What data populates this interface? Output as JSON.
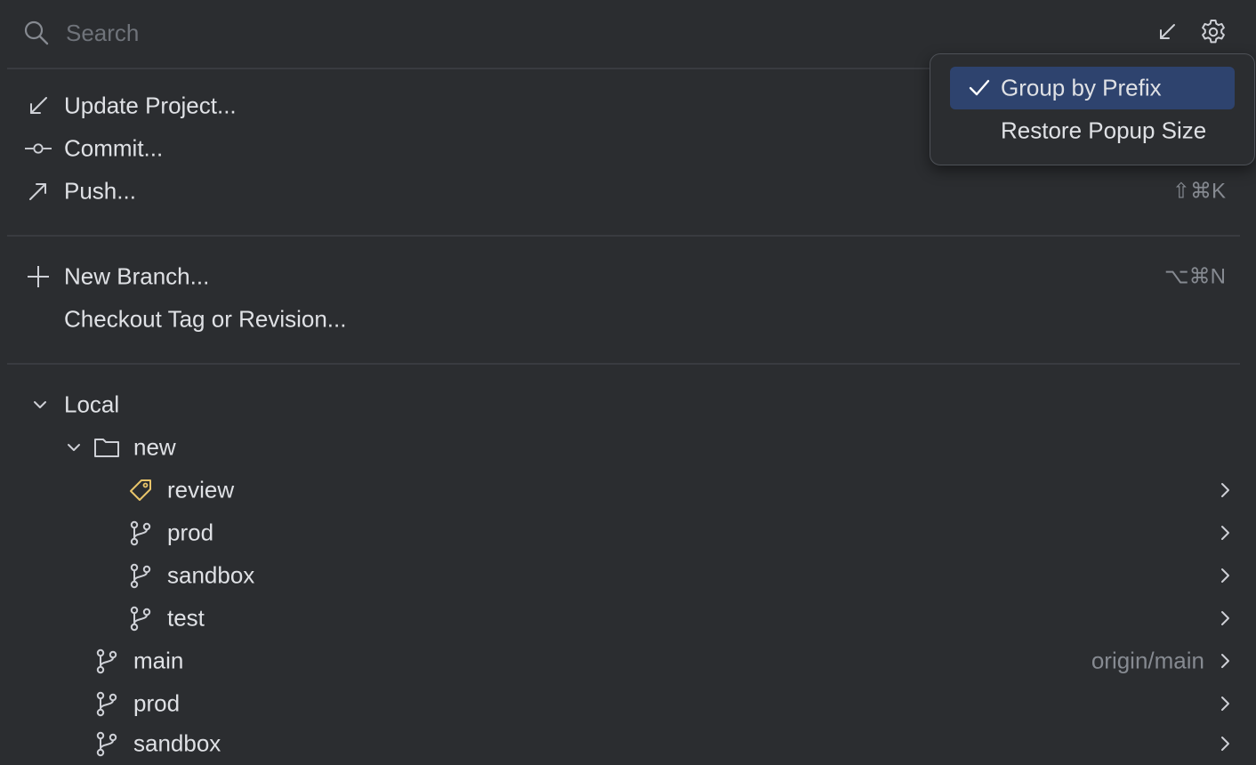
{
  "search": {
    "placeholder": "Search",
    "value": ""
  },
  "actions": [
    {
      "label": "Update Project...",
      "icon": "update-arrow-icon",
      "shortcut": ""
    },
    {
      "label": "Commit...",
      "icon": "commit-icon",
      "shortcut": ""
    },
    {
      "label": "Push...",
      "icon": "push-arrow-icon",
      "shortcut": "⇧⌘K"
    }
  ],
  "branch_actions": [
    {
      "label": "New Branch...",
      "icon": "plus-icon",
      "shortcut": "⌥⌘N"
    },
    {
      "label": "Checkout Tag or Revision...",
      "icon": "",
      "shortcut": ""
    }
  ],
  "tree": {
    "local_label": "Local",
    "group_label": "new",
    "group_items": [
      {
        "label": "review",
        "icon": "tag-icon"
      },
      {
        "label": "prod",
        "icon": "branch-icon"
      },
      {
        "label": "sandbox",
        "icon": "branch-icon"
      },
      {
        "label": "test",
        "icon": "branch-icon"
      }
    ],
    "branches": [
      {
        "label": "main",
        "icon": "branch-icon",
        "tracking": "origin/main"
      },
      {
        "label": "prod",
        "icon": "branch-icon",
        "tracking": ""
      },
      {
        "label": "sandbox",
        "icon": "branch-icon",
        "tracking": ""
      }
    ]
  },
  "popup": {
    "items": [
      {
        "label": "Group by Prefix",
        "checked": true
      },
      {
        "label": "Restore Popup Size",
        "checked": false
      }
    ]
  },
  "colors": {
    "background": "#2b2d30",
    "selection": "#2e436e",
    "tag": "#e8c46a",
    "muted": "#868a91"
  }
}
